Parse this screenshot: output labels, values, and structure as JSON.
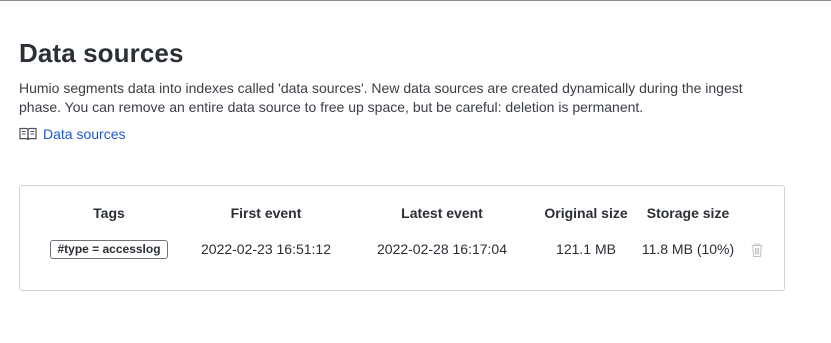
{
  "header": {
    "title": "Data sources",
    "description": "Humio segments data into indexes called 'data sources'. New data sources are created dynamically during the ingest phase. You can remove an entire data source to free up space, but be careful: deletion is permanent.",
    "doc_link": {
      "label": "Data sources",
      "icon": "book-icon",
      "color": "#1f57c9"
    }
  },
  "table": {
    "columns": [
      "Tags",
      "First event",
      "Latest event",
      "Original size",
      "Storage size"
    ],
    "rows": [
      {
        "tag": "#type = accesslog",
        "first_event": "2022-02-23 16:51:12",
        "latest_event": "2022-02-28 16:17:04",
        "original_size": "121.1 MB",
        "storage_size": "11.8 MB (10%)",
        "action_icon": "trash-icon"
      }
    ]
  }
}
